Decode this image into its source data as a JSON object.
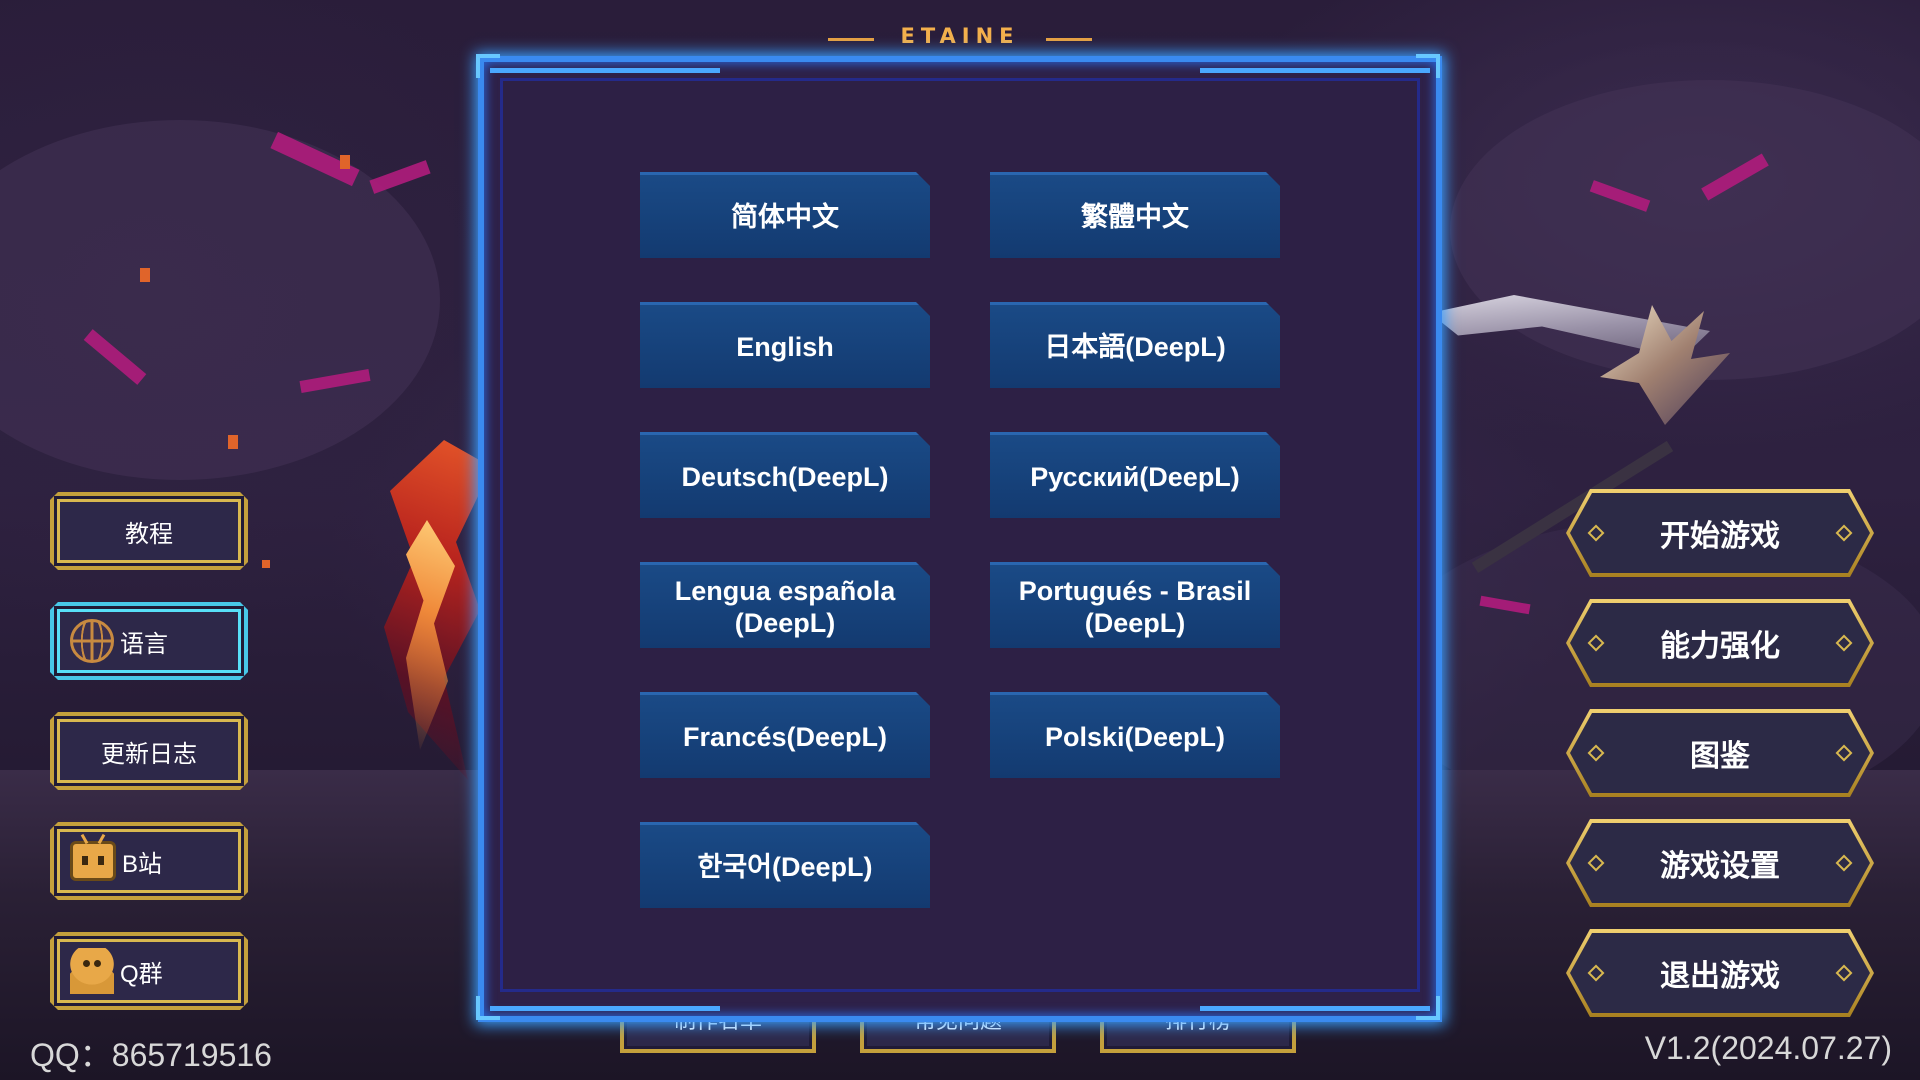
{
  "title": {
    "brand": "ETAINE"
  },
  "side_menu": {
    "tutorial": "教程",
    "language": "语言",
    "changelog": "更新日志",
    "bilibili": "B站",
    "qq_group": "Q群"
  },
  "main_menu": {
    "start_game": "开始游戏",
    "upgrade": "能力强化",
    "codex": "图鉴",
    "settings": "游戏设置",
    "quit": "退出游戏"
  },
  "bottom_menu": {
    "credits": "制作名单",
    "faq": "常见问题",
    "leaderboard": "排行榜"
  },
  "footer": {
    "qq": "QQ：865719516",
    "version": "V1.2(2024.07.27)"
  },
  "language_panel": {
    "options": [
      "简体中文",
      "繁體中文",
      "English",
      "日本語(DeepL)",
      "Deutsch(DeepL)",
      "Русский(DeepL)",
      "Lengua española\n(DeepL)",
      "Portugués - Brasil\n(DeepL)",
      "Francés(DeepL)",
      "Polski(DeepL)",
      "한국어(DeepL)"
    ]
  },
  "icons": {
    "language": "globe-icon",
    "bilibili": "bilibili-tv-icon",
    "qq": "qq-penguin-icon"
  },
  "colors": {
    "panel_border": "#3a8af0",
    "button_blue": "#1a4a86",
    "gold_border": "#c4a03c",
    "active_border": "#48c8e8"
  }
}
